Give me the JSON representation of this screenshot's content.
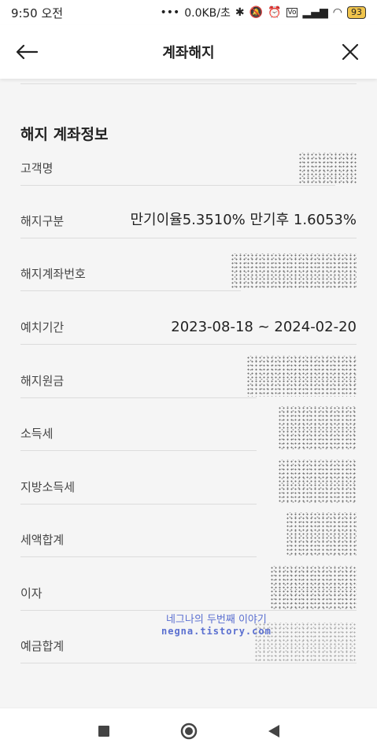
{
  "status": {
    "time": "9:50",
    "ampm": "오전",
    "speed": "0.0KB/초",
    "battery": "93"
  },
  "header": {
    "title": "계좌해지"
  },
  "section": {
    "title": "해지 계좌정보"
  },
  "rows": [
    {
      "label": "고객명",
      "value": ""
    },
    {
      "label": "해지구분",
      "value": "만기이율5.3510% 만기후 1.6053%"
    },
    {
      "label": "해지계좌번호",
      "value": ""
    },
    {
      "label": "예치기간",
      "value": "2023-08-18 ~ 2024-02-20"
    },
    {
      "label": "해지원금",
      "value": ""
    },
    {
      "label": "소득세",
      "value": ""
    },
    {
      "label": "지방소득세",
      "value": ""
    },
    {
      "label": "세액합계",
      "value": ""
    },
    {
      "label": "이자",
      "value": ""
    },
    {
      "label": "예금합계",
      "value": ""
    }
  ],
  "watermark": {
    "line1": "네그나의 두번째 이야기",
    "line2": "negna.tistory.com"
  },
  "icons": {
    "back": "arrow-left-icon",
    "close": "close-icon",
    "recent": "square-icon",
    "home": "circle-icon",
    "navback": "triangle-back-icon"
  }
}
